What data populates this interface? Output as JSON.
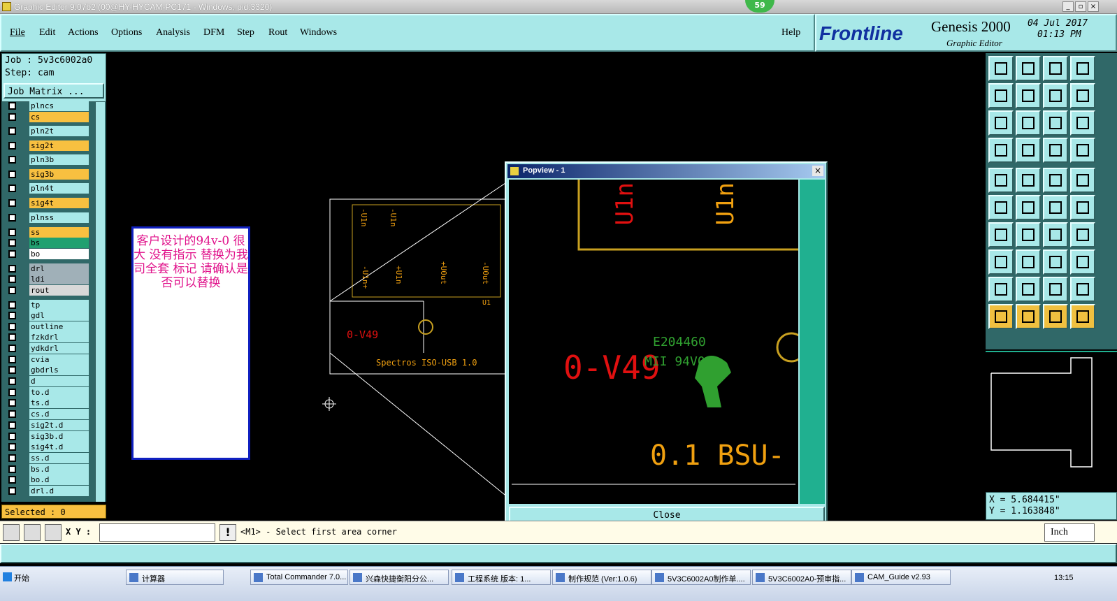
{
  "window": {
    "title": "Graphic Editor 9.07b2 (00@HY-HYCAM-PC171 - Windows, pid:3320)",
    "badge": "59"
  },
  "menu": {
    "items": [
      "File",
      "Edit",
      "Actions",
      "Options",
      "Analysis",
      "DFM",
      "Step",
      "Rout",
      "Windows"
    ],
    "help": "Help"
  },
  "brand": {
    "logo": "Frontline",
    "product": "Genesis 2000",
    "subtitle": "Graphic Editor",
    "date": "04 Jul 2017",
    "time": "01:13 PM"
  },
  "job": {
    "job_line": "Job : 5v3c6002a0",
    "step_line": "Step: cam",
    "matrix_button": "Job Matrix ..."
  },
  "layers": [
    {
      "name": "plncs",
      "color": "#a8e8e8"
    },
    {
      "name": "cs",
      "color": "#f8c040"
    },
    {
      "name": "pln2t",
      "color": "#a8e8e8"
    },
    {
      "name": "sig2t",
      "color": "#f8c040"
    },
    {
      "name": "pln3b",
      "color": "#a8e8e8"
    },
    {
      "name": "sig3b",
      "color": "#f8c040"
    },
    {
      "name": "pln4t",
      "color": "#a8e8e8"
    },
    {
      "name": "sig4t",
      "color": "#f8c040"
    },
    {
      "name": "plnss",
      "color": "#a8e8e8"
    },
    {
      "name": "ss",
      "color": "#f8c040"
    },
    {
      "name": "bs",
      "color": "#20a070"
    },
    {
      "name": "bo",
      "color": "#ffffff"
    },
    {
      "name": "drl",
      "color": "#a0b0b8"
    },
    {
      "name": "ldi",
      "color": "#a0b0b8"
    },
    {
      "name": "rout",
      "color": "#d8d8d8"
    },
    {
      "name": "tp",
      "color": "#a8e8e8"
    },
    {
      "name": "gdl",
      "color": "#a8e8e8"
    },
    {
      "name": "outline",
      "color": "#a8e8e8"
    },
    {
      "name": "fzkdrl",
      "color": "#a8e8e8"
    },
    {
      "name": "ydkdrl",
      "color": "#a8e8e8"
    },
    {
      "name": "cvia",
      "color": "#a8e8e8"
    },
    {
      "name": "gbdrls",
      "color": "#a8e8e8"
    },
    {
      "name": "d",
      "color": "#a8e8e8"
    },
    {
      "name": "to.d",
      "color": "#a8e8e8"
    },
    {
      "name": "ts.d",
      "color": "#a8e8e8"
    },
    {
      "name": "cs.d",
      "color": "#a8e8e8"
    },
    {
      "name": "sig2t.d",
      "color": "#a8e8e8"
    },
    {
      "name": "sig3b.d",
      "color": "#a8e8e8"
    },
    {
      "name": "sig4t.d",
      "color": "#a8e8e8"
    },
    {
      "name": "ss.d",
      "color": "#a8e8e8"
    },
    {
      "name": "bs.d",
      "color": "#a8e8e8"
    },
    {
      "name": "bo.d",
      "color": "#a8e8e8"
    },
    {
      "name": "drl.d",
      "color": "#a8e8e8"
    }
  ],
  "selected": "Selected : 0",
  "note": {
    "text": "客户设计的94v-0 很大 没有指示 替换为我司全套 标记 请确认是 否可以替换"
  },
  "canvas_text": {
    "labels_top": [
      "-U1n",
      "-U1n"
    ],
    "labels_mid": [
      "-U1n+",
      "+U1n",
      "+U0ut",
      "-U0ut"
    ],
    "u1": "U1",
    "v0": "0-V49",
    "usb": "Spectros ISO-USB 1.0"
  },
  "popview": {
    "title": "Popview - 1",
    "close": "Close",
    "big_v0": "0-V49",
    "usb": "0.1 BSU-",
    "e_code": "E204460",
    "m_code": "MII 94V0",
    "u1a": "U1n",
    "u1b": "U1n"
  },
  "command": {
    "xy_label": "X Y :",
    "xy_value": "",
    "prompt": "<M1> - Select first area corner",
    "unit": "Inch"
  },
  "coords": {
    "x": "X =  5.684415\"",
    "y": "Y =  1.163848\""
  },
  "taskbar": {
    "start": "开始",
    "tasks": [
      "计算器",
      "Total Commander 7.0...",
      "兴森快捷衡阳分公...",
      "工程系统  版本: 1...",
      "制作规范 (Ver:1.0.6)",
      "5V3C6002A0制作单....",
      "5V3C6002A0-预审指...",
      "CAM_Guide v2.93"
    ],
    "clock": "13:15"
  }
}
